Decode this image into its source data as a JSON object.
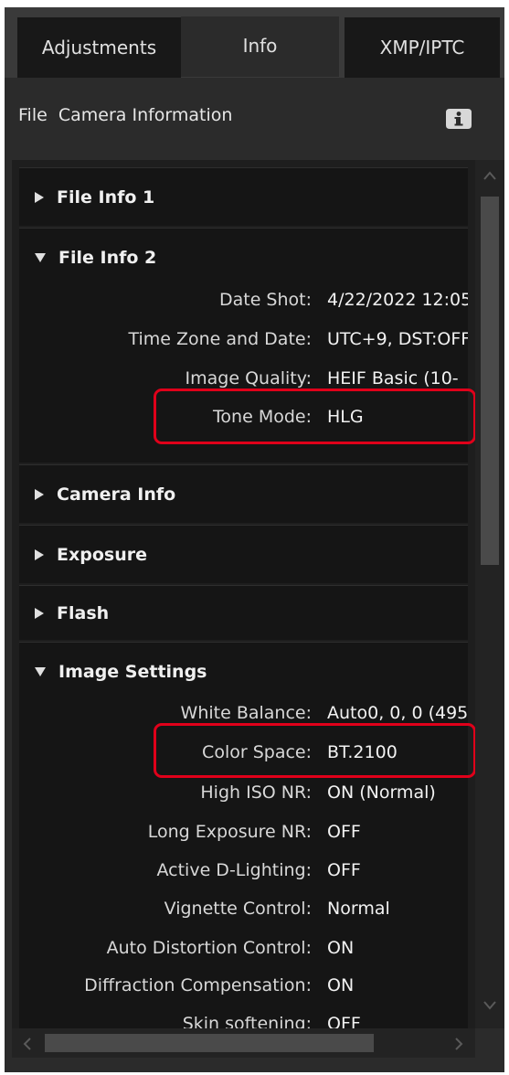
{
  "tabs": [
    {
      "label": "Adjustments",
      "active": false
    },
    {
      "label": "Info",
      "active": true
    },
    {
      "label": "XMP/IPTC",
      "active": false
    }
  ],
  "header": {
    "title": "File  Camera Information",
    "icon": "info-icon"
  },
  "sections": {
    "file_info_1": {
      "title": "File Info 1",
      "expanded": false
    },
    "file_info_2": {
      "title": "File Info 2",
      "expanded": true,
      "rows": [
        {
          "label": "Date Shot:",
          "value": "4/22/2022 12:05"
        },
        {
          "label": "Time Zone and Date:",
          "value": "UTC+9, DST:OFF"
        },
        {
          "label": "Image Quality:",
          "value": "HEIF Basic (10-"
        },
        {
          "label": "Tone Mode:",
          "value": "HLG",
          "highlighted": true
        }
      ]
    },
    "camera_info": {
      "title": "Camera Info",
      "expanded": false
    },
    "exposure": {
      "title": "Exposure",
      "expanded": false
    },
    "flash": {
      "title": "Flash",
      "expanded": false
    },
    "image_settings": {
      "title": "Image Settings",
      "expanded": true,
      "rows": [
        {
          "label": "White Balance:",
          "value": "Auto0, 0, 0 (495"
        },
        {
          "label": "Color Space:",
          "value": "BT.2100",
          "highlighted": true
        },
        {
          "label": "High ISO NR:",
          "value": "ON (Normal)"
        },
        {
          "label": "Long Exposure NR:",
          "value": "OFF"
        },
        {
          "label": "Active D-Lighting:",
          "value": "OFF"
        },
        {
          "label": "Vignette Control:",
          "value": "Normal"
        },
        {
          "label": "Auto Distortion Control:",
          "value": "ON"
        },
        {
          "label": "Diffraction Compensation:",
          "value": "ON"
        },
        {
          "label": "Skin softening:",
          "value": "OFF"
        }
      ]
    }
  },
  "colors": {
    "highlight": "#e0001a",
    "panel": "#2b2b2b",
    "section": "#151515"
  }
}
